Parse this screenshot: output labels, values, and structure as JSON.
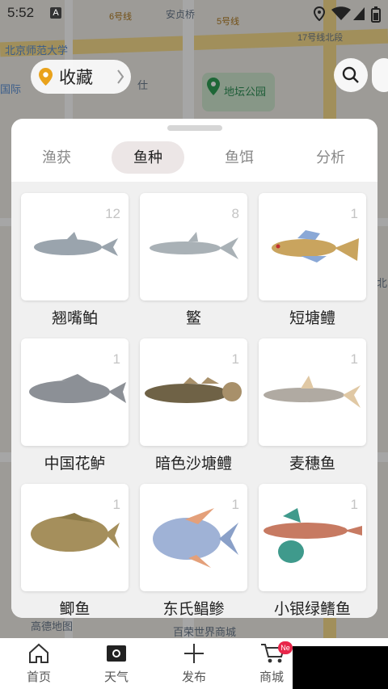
{
  "status_bar": {
    "time": "5:52",
    "a_badge": "A"
  },
  "map": {
    "labels": [
      "北京师范大学",
      "安贞桥",
      "地坛公园",
      "6号线",
      "5号线",
      "17号线北段",
      "高德地图",
      "百荣世界商城",
      "国际",
      "北",
      "仕"
    ],
    "favorites_label": "收藏"
  },
  "sheet": {
    "tabs": [
      {
        "label": "渔获"
      },
      {
        "label": "鱼种",
        "active": true
      },
      {
        "label": "鱼饵"
      },
      {
        "label": "分析"
      }
    ],
    "fish": [
      {
        "name": "翘嘴鲌",
        "count": "12",
        "color": "#9aa4ad"
      },
      {
        "name": "鳘",
        "count": "8",
        "color": "#a9b1b6"
      },
      {
        "name": "短塘鳢",
        "count": "1",
        "color": "#c9a45e"
      },
      {
        "name": "中国花鲈",
        "count": "1",
        "color": "#8c9096"
      },
      {
        "name": "暗色沙塘鳢",
        "count": "1",
        "color": "#6f6246"
      },
      {
        "name": "麦穗鱼",
        "count": "1",
        "color": "#b0aaa2"
      },
      {
        "name": "鲫鱼",
        "count": "1",
        "color": "#a58f5c"
      },
      {
        "name": "东氏鲳鲹",
        "count": "1",
        "color": "#9fb2d6"
      },
      {
        "name": "小银绿鳍鱼",
        "count": "1",
        "color": "#c77a62"
      }
    ]
  },
  "bottom_nav": {
    "items": [
      {
        "label": "首页"
      },
      {
        "label": "天气"
      },
      {
        "label": "发布"
      },
      {
        "label": "商城"
      }
    ],
    "badge": "Ne"
  }
}
